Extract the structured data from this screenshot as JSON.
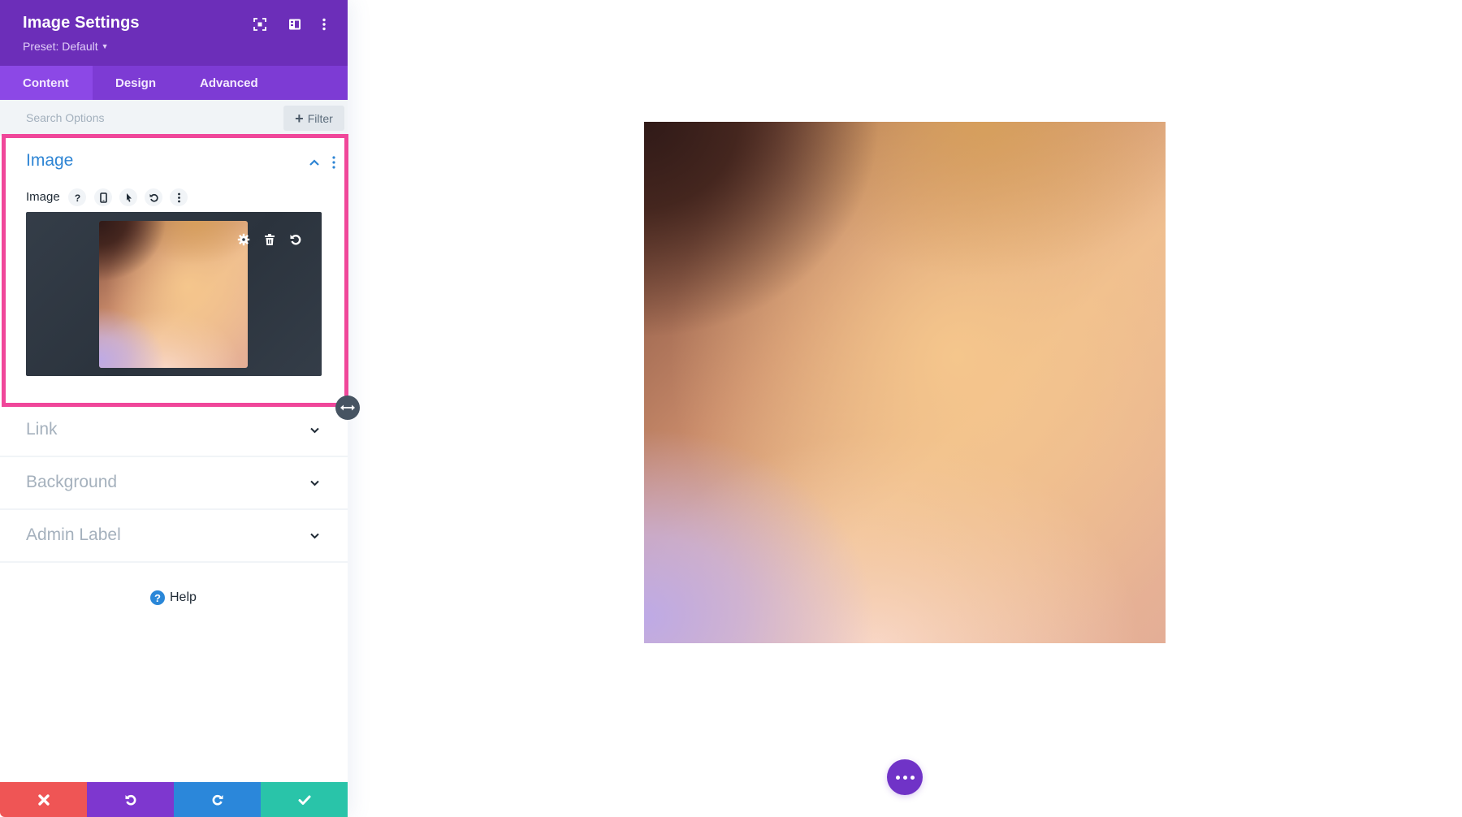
{
  "panel": {
    "title": "Image Settings",
    "preset_label": "Preset: Default",
    "header_icons": [
      "expand-icon",
      "split-view-icon",
      "more-options-icon"
    ],
    "tabs": [
      {
        "label": "Content",
        "active": true
      },
      {
        "label": "Design",
        "active": false
      },
      {
        "label": "Advanced",
        "active": false
      }
    ],
    "search": {
      "placeholder": "Search Options",
      "value": ""
    },
    "filter_label": "Filter",
    "sections": {
      "image": {
        "title": "Image",
        "expanded": true,
        "field_label": "Image",
        "field_icons": [
          "help-icon",
          "responsive-phone-icon",
          "hover-pointer-icon",
          "reset-icon",
          "more-options-icon"
        ],
        "upload_actions": [
          "settings-gear-icon",
          "trash-icon",
          "reset-icon"
        ]
      },
      "collapsed": [
        {
          "title": "Link"
        },
        {
          "title": "Background"
        },
        {
          "title": "Admin Label"
        }
      ]
    },
    "help_label": "Help",
    "footer": {
      "actions": [
        "cancel",
        "undo",
        "redo",
        "save"
      ]
    }
  },
  "colors": {
    "header_bg": "#6c2eb9",
    "tabs_bg": "#7d3bd4",
    "active_tab_bg": "#8c48e6",
    "section_title": "#2e85d4",
    "highlight": "#f0479a",
    "cancel": "#ef5555",
    "undo": "#7e37cf",
    "redo": "#2b87da",
    "save": "#29c4a9",
    "fab": "#7033c7"
  }
}
